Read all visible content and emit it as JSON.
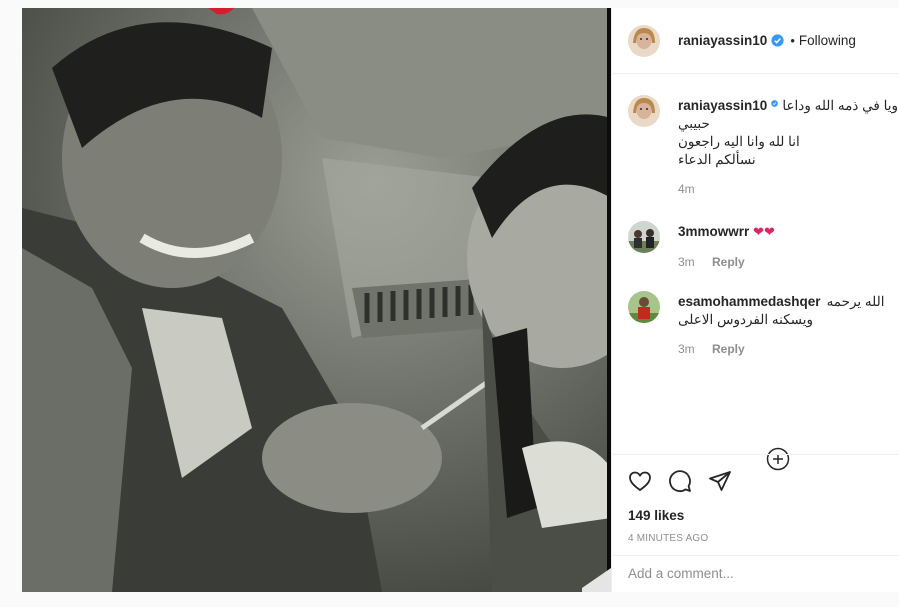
{
  "post": {
    "username": "raniayassin10",
    "follow_status": "Following",
    "separator": "•"
  },
  "caption": {
    "username": "raniayassin10",
    "lines": [
      "ويا في ذمه الله وداعا",
      "حبيبي",
      "انا لله وانا اليه راجعون",
      "نسألكم الدعاء"
    ],
    "time": "4m"
  },
  "comments": [
    {
      "username": "3mmowwrr",
      "text": "❤❤",
      "time": "3m",
      "reply": "Reply"
    },
    {
      "username": "esamohammedashqer",
      "text_line1": "الله يرحمه",
      "text_line2": "ويسكنه الفردوس الاعلى",
      "time": "3m",
      "reply": "Reply"
    }
  ],
  "actions": {
    "likes": "149 likes",
    "timestamp": "4 MINUTES AGO",
    "comment_placeholder": "Add a comment..."
  },
  "icons": {
    "verified": "verified-badge-icon",
    "like": "heart-icon",
    "comment": "comment-bubble-icon",
    "share": "paper-plane-icon",
    "more": "plus-circle-icon"
  },
  "colors": {
    "verified": "#3897f0",
    "heart": "#e0245e",
    "muted": "#8e8e8e"
  }
}
